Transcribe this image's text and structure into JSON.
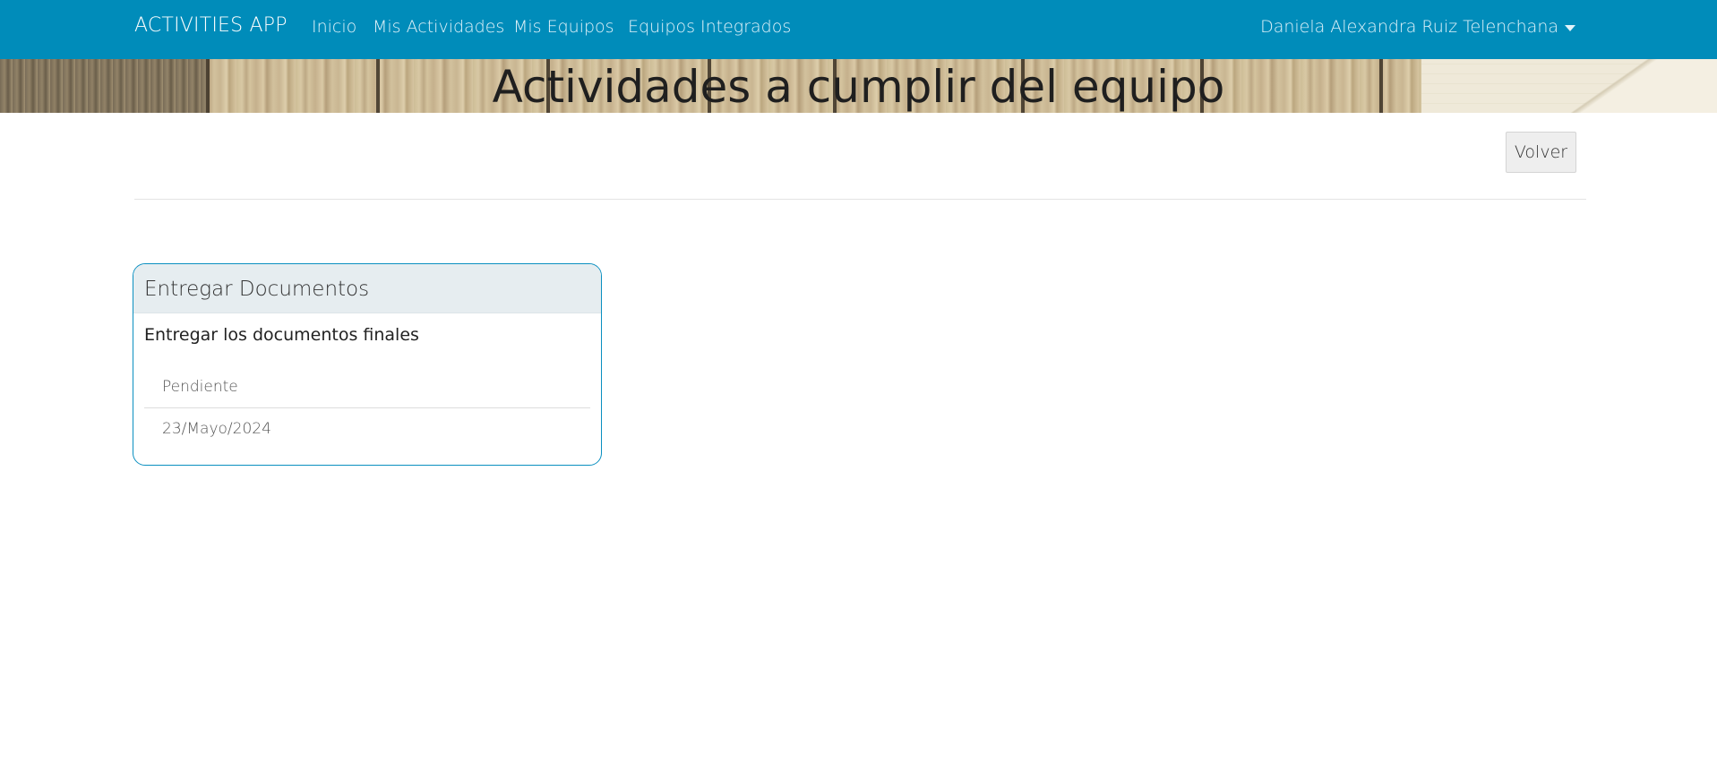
{
  "navbar": {
    "brand": "ACTIVITIES APP",
    "links": [
      "Inicio",
      "Mis Actividades",
      "Mis Equipos",
      "Equipos Integrados"
    ],
    "user_name": "Daniela Alexandra Ruiz Telenchana",
    "user_menu_icon": "caret-down-icon"
  },
  "banner": {
    "title": "Actividades a cumplir del equipo"
  },
  "actions": {
    "back_label": "Volver"
  },
  "activities": [
    {
      "title": "Entregar Documentos",
      "description": "Entregar los documentos finales",
      "status": "Pendiente",
      "due_date": "23/Mayo/2024"
    }
  ],
  "colors": {
    "navbar": "#008cba",
    "card_border": "#0a8fc0",
    "card_header": "#e6edf0"
  }
}
